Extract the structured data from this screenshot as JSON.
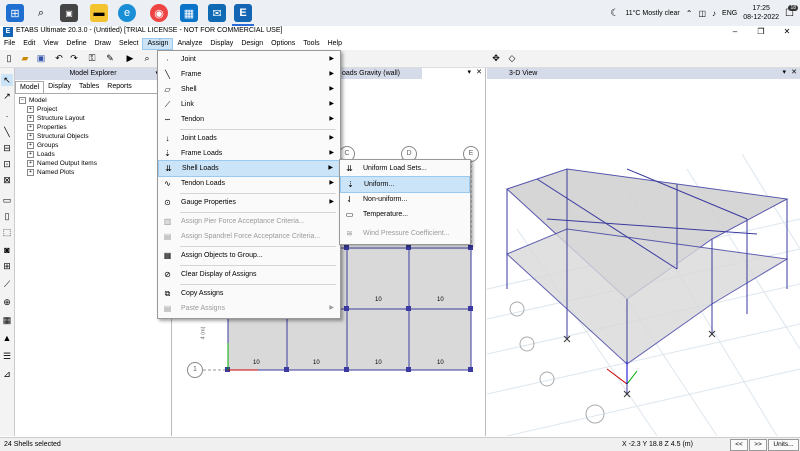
{
  "taskbar": {
    "weather": "11°C  Mostly clear",
    "language": "ENG",
    "time": "17:25",
    "date": "08-12-2022",
    "notification_count": "18"
  },
  "window": {
    "title": "ETABS Ultimate 20.3.0 - (Untitled)  [TRIAL LICENSE - NOT FOR COMMERCIAL USE]"
  },
  "menubar": [
    "File",
    "Edit",
    "View",
    "Define",
    "Draw",
    "Select",
    "Assign",
    "Analyze",
    "Display",
    "Design",
    "Options",
    "Tools",
    "Help"
  ],
  "explorer": {
    "title": "Model Explorer",
    "tabs": [
      "Model",
      "Display",
      "Tables",
      "Reports"
    ],
    "root": "Model",
    "items": [
      "Project",
      "Structure Layout",
      "Properties",
      "Structural Objects",
      "Groups",
      "Loads",
      "Named Output Items",
      "Named Plots"
    ]
  },
  "plan_view": {
    "tab_title": "oads Gravity (wall)",
    "grid_labels": [
      "C",
      "D",
      "E",
      "1"
    ],
    "load_value": "10",
    "dimension": "4 (m)"
  },
  "view3d": {
    "tab_title": "3-D View"
  },
  "assign_menu": {
    "items": [
      {
        "label": "Joint",
        "arrow": "▶",
        "icon": "joint-icon"
      },
      {
        "label": "Frame",
        "arrow": "▶",
        "icon": "frame-icon"
      },
      {
        "label": "Shell",
        "arrow": "▶",
        "icon": "shell-icon"
      },
      {
        "label": "Link",
        "arrow": "▶",
        "icon": "link-icon"
      },
      {
        "label": "Tendon",
        "arrow": "▶",
        "icon": "tendon-icon"
      },
      {
        "label": "Joint Loads",
        "arrow": "▶",
        "icon": "joint-loads-icon"
      },
      {
        "label": "Frame Loads",
        "arrow": "▶",
        "icon": "frame-loads-icon"
      },
      {
        "label": "Shell Loads",
        "arrow": "▶",
        "icon": "shell-loads-icon"
      },
      {
        "label": "Tendon Loads",
        "arrow": "▶",
        "icon": "tendon-loads-icon"
      },
      {
        "label": "Gauge Properties",
        "arrow": "▶",
        "icon": "gauge-icon"
      },
      {
        "label": "Assign Pier Force Acceptance Criteria...",
        "arrow": "",
        "icon": "pier-icon"
      },
      {
        "label": "Assign Spandrel Force Acceptance Criteria...",
        "arrow": "",
        "icon": "spandrel-icon"
      },
      {
        "label": "Assign Objects to Group...",
        "arrow": "",
        "icon": "group-icon"
      },
      {
        "label": "Clear Display of Assigns",
        "arrow": "",
        "icon": "clear-icon"
      },
      {
        "label": "Copy Assigns",
        "arrow": "",
        "icon": "copy-icon"
      },
      {
        "label": "Paste Assigns",
        "arrow": "▶",
        "icon": "paste-icon"
      }
    ]
  },
  "shell_loads_submenu": {
    "items": [
      {
        "label": "Uniform Load Sets..."
      },
      {
        "label": "Uniform..."
      },
      {
        "label": "Non-uniform..."
      },
      {
        "label": "Temperature..."
      },
      {
        "label": "Wind Pressure Coefficient..."
      }
    ]
  },
  "statusbar": {
    "selection": "24 Shells selected",
    "coordinates": "X -2.3  Y 18.8  Z 4.5 (m)",
    "prev_button": "<<",
    "next_button": ">>",
    "units_button": "Units..."
  },
  "colors": {
    "accent": "#2d6bd6",
    "menu_highlight": "#cce4f7",
    "frame_line": "#3a3aa0",
    "slab_fill": "#d9d9d9"
  }
}
